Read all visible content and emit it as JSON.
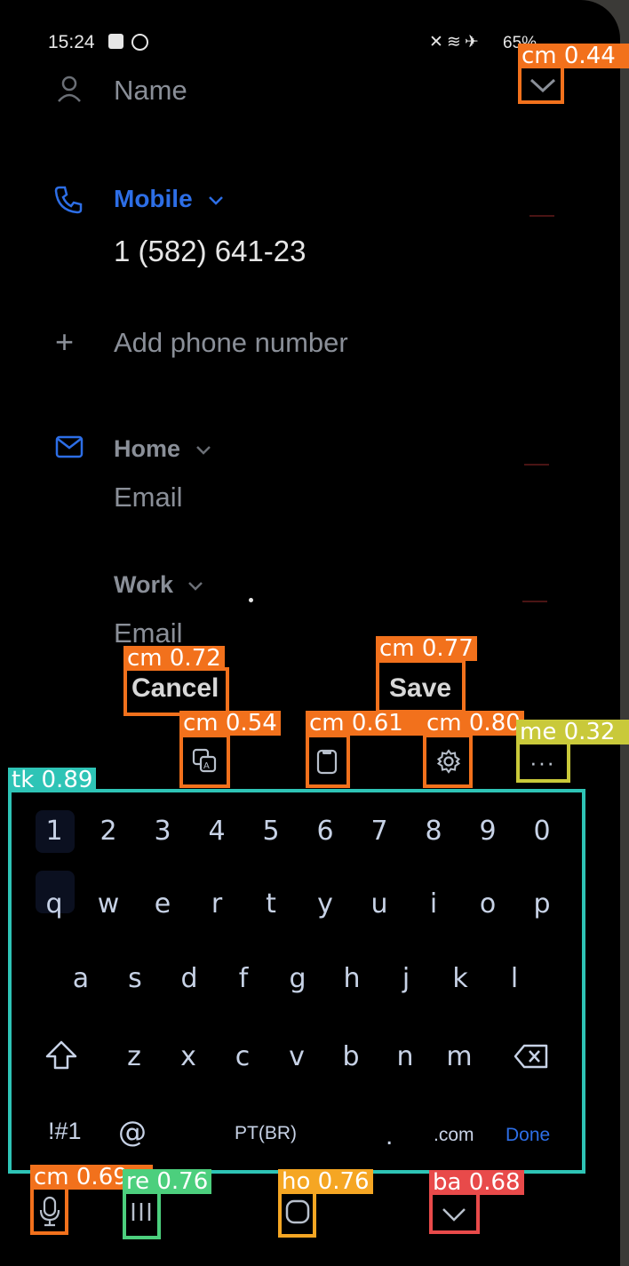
{
  "status_bar": {
    "time": "15:24",
    "battery": "65%"
  },
  "form": {
    "name_placeholder": "Name",
    "phone_label": "Mobile",
    "phone_value": "1 (582) 641-23",
    "add_phone": "Add phone number",
    "email1_label": "Home",
    "email1_placeholder": "Email",
    "email2_label": "Work",
    "email2_placeholder": "Email"
  },
  "actions": {
    "cancel": "Cancel",
    "save": "Save"
  },
  "keyboard": {
    "row1": [
      "1",
      "2",
      "3",
      "4",
      "5",
      "6",
      "7",
      "8",
      "9",
      "0"
    ],
    "row2": [
      "q",
      "w",
      "e",
      "r",
      "t",
      "y",
      "u",
      "i",
      "o",
      "p"
    ],
    "row3": [
      "a",
      "s",
      "d",
      "f",
      "g",
      "h",
      "j",
      "k",
      "l"
    ],
    "row4": [
      "z",
      "x",
      "c",
      "v",
      "b",
      "n",
      "m"
    ],
    "symbols": "!#1",
    "at": "@",
    "space": "PT(BR)",
    "period": ".",
    "dotcom": ".com",
    "done": "Done"
  },
  "detections": {
    "cm_top": "cm 0.44",
    "cancel": "cm 0.72",
    "save": "cm 0.77",
    "translate": "cm 0.54",
    "clipboard": "cm 0.61",
    "settings": "cm 0.80",
    "more": "me 0.32",
    "keyboard": "tk 0.89",
    "mic": "cm 0.69",
    "recent": "re 0.76",
    "home": "ho 0.76",
    "back": "ba 0.68"
  },
  "colors": {
    "accent": "#2d6ee6",
    "cm": "#f2711c",
    "tk": "#2ec4b6",
    "me": "#c9c93a",
    "re": "#4ccf7d",
    "ho": "#f5a623",
    "ba": "#e84a4a"
  }
}
